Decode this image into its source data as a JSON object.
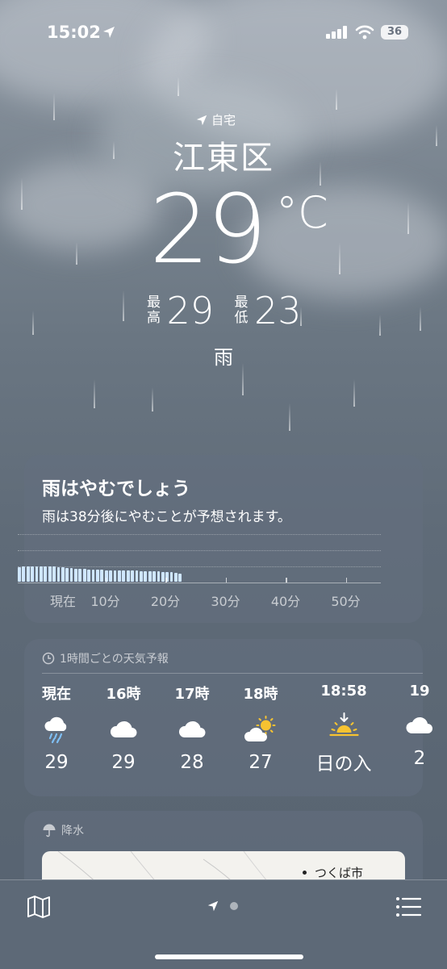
{
  "status_bar": {
    "time": "15:02",
    "battery": "36"
  },
  "location": {
    "label": "自宅",
    "city": "江東区"
  },
  "current": {
    "temp": "29",
    "unit": "°C",
    "high_label": "最高",
    "high": "29",
    "low_label": "最低",
    "low": "23",
    "condition": "雨"
  },
  "rain_card": {
    "title": "雨はやむでしょう",
    "subtitle": "雨は38分後にやむことが予想されます。",
    "axis_labels": [
      "現在",
      "10分",
      "20分",
      "30分",
      "40分",
      "50分"
    ],
    "minutes_until_stop": 38,
    "intensity": [
      0.9,
      0.95,
      0.95,
      0.95,
      0.95,
      0.95,
      0.95,
      0.95,
      0.95,
      0.9,
      0.9,
      0.85,
      0.85,
      0.8,
      0.8,
      0.8,
      0.75,
      0.75,
      0.75,
      0.75,
      0.7,
      0.7,
      0.7,
      0.7,
      0.7,
      0.7,
      0.7,
      0.7,
      0.65,
      0.65,
      0.65,
      0.65,
      0.65,
      0.6,
      0.6,
      0.6,
      0.55,
      0.5
    ]
  },
  "hourly": {
    "header": "1時間ごとの天気予報",
    "items": [
      {
        "time": "現在",
        "icon": "rain-cloud-icon",
        "value": "29"
      },
      {
        "time": "16時",
        "icon": "cloud-icon",
        "value": "29"
      },
      {
        "time": "17時",
        "icon": "cloud-icon",
        "value": "28"
      },
      {
        "time": "18時",
        "icon": "partly-sunny-icon",
        "value": "27"
      },
      {
        "time": "18:58",
        "icon": "sunset-icon",
        "value": "日の入"
      },
      {
        "time": "19",
        "icon": "cloud-icon",
        "value": "2"
      }
    ]
  },
  "precip_card": {
    "header": "降水",
    "map_label": "つくば市"
  },
  "colors": {
    "accent_bar": "#cfe6ff",
    "sun": "#f7c331"
  }
}
